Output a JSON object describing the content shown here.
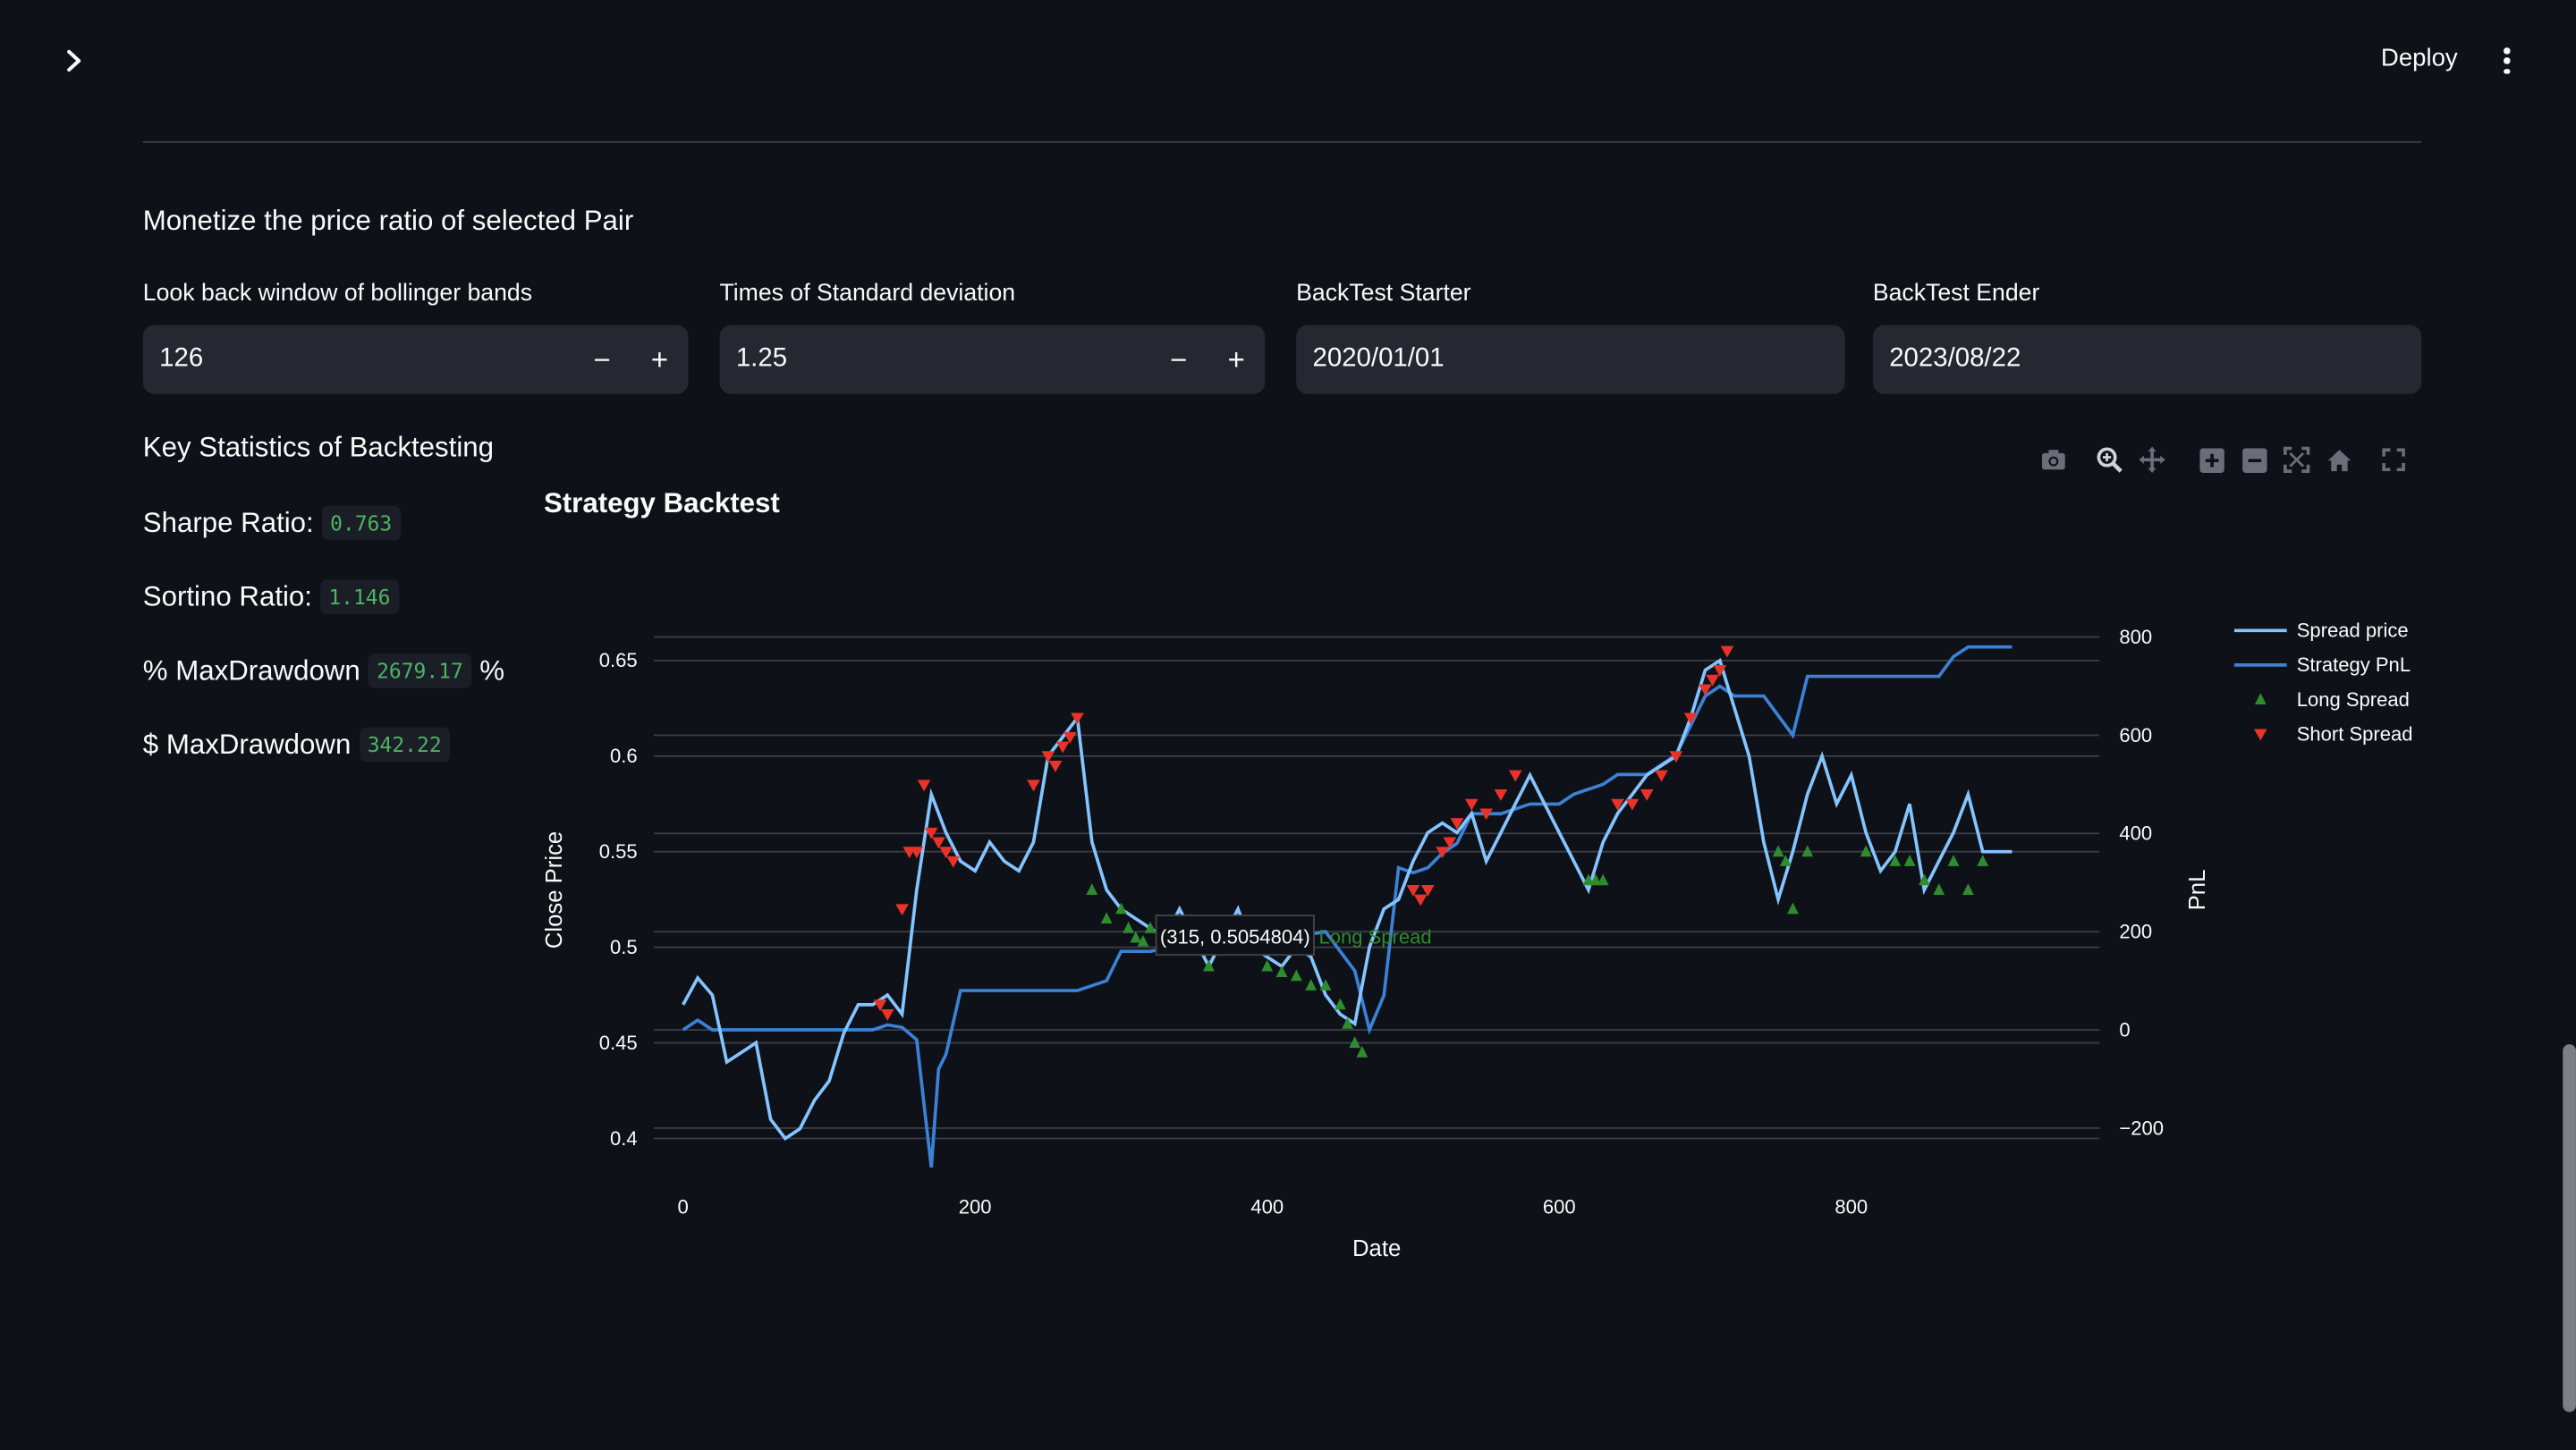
{
  "header": {
    "deploy_label": "Deploy"
  },
  "subtitle": "Monetize the price ratio of selected Pair",
  "inputs": {
    "lookback": {
      "label": "Look back window of bollinger bands",
      "value": "126",
      "minus": "−",
      "plus": "+"
    },
    "std_times": {
      "label": "Times of Standard deviation",
      "value": "1.25",
      "minus": "−",
      "plus": "+"
    },
    "start": {
      "label": "BackTest Starter",
      "value": "2020/01/01"
    },
    "end": {
      "label": "BackTest Ender",
      "value": "2023/08/22"
    }
  },
  "stats": {
    "title": "Key Statistics of Backtesting",
    "sharpe": {
      "label": "Sharpe Ratio:",
      "value": "0.763"
    },
    "sortino": {
      "label": "Sortino Ratio:",
      "value": "1.146"
    },
    "pct_mdd": {
      "label": "% MaxDrawdown",
      "value": "2679.17",
      "suffix": "%"
    },
    "usd_mdd": {
      "label": "$ MaxDrawdown",
      "value": "342.22"
    }
  },
  "modebar_icons": [
    "camera-icon",
    "zoom-icon",
    "pan-icon",
    "zoom-in-icon",
    "zoom-out-icon",
    "autoscale-icon",
    "reset-axes-icon",
    "fullscreen-icon"
  ],
  "chart_data": {
    "type": "line",
    "title": "Strategy Backtest",
    "xlabel": "Date",
    "ylabel": "Close Price",
    "y2label": "PnL",
    "xlim": [
      -20,
      970
    ],
    "ylim": [
      0.39,
      0.67
    ],
    "y2lim": [
      -260,
      830
    ],
    "x_ticks": [
      0,
      200,
      400,
      600,
      800
    ],
    "y_ticks": [
      0.4,
      0.45,
      0.5,
      0.55,
      0.6,
      0.65
    ],
    "y_tick_labels": [
      "0.4",
      "0.45",
      "0.5",
      "0.55",
      "0.6",
      "0.65"
    ],
    "y2_ticks": [
      -200,
      0,
      200,
      400,
      600,
      800
    ],
    "y2_tick_labels": [
      "−200",
      "0",
      "200",
      "400",
      "600",
      "800"
    ],
    "legend_position": "top-right",
    "colors": {
      "spread": "#84c4ff",
      "pnl": "#3b82d6",
      "long": "#2e8b2e",
      "short": "#e8332a",
      "grid": "#3a3d46",
      "text": "#fafafa"
    },
    "series": [
      {
        "name": "Spread price",
        "axis": "y",
        "x": [
          0,
          10,
          20,
          30,
          40,
          50,
          60,
          70,
          80,
          90,
          100,
          110,
          120,
          130,
          140,
          150,
          160,
          170,
          180,
          190,
          200,
          210,
          220,
          230,
          240,
          250,
          260,
          270,
          280,
          290,
          300,
          310,
          320,
          330,
          340,
          350,
          360,
          370,
          380,
          390,
          400,
          410,
          420,
          430,
          440,
          450,
          460,
          470,
          480,
          490,
          500,
          510,
          520,
          530,
          540,
          550,
          560,
          570,
          580,
          590,
          600,
          610,
          620,
          630,
          640,
          650,
          660,
          670,
          680,
          690,
          700,
          710,
          720,
          730,
          740,
          750,
          760,
          770,
          780,
          790,
          800,
          810,
          820,
          830,
          840,
          850,
          860,
          870,
          880,
          890,
          910
        ],
        "values": [
          0.47,
          0.484,
          0.475,
          0.44,
          0.445,
          0.45,
          0.41,
          0.4,
          0.405,
          0.42,
          0.43,
          0.455,
          0.47,
          0.47,
          0.475,
          0.465,
          0.53,
          0.58,
          0.56,
          0.545,
          0.54,
          0.555,
          0.545,
          0.54,
          0.555,
          0.6,
          0.61,
          0.62,
          0.555,
          0.53,
          0.52,
          0.515,
          0.51,
          0.505,
          0.52,
          0.505,
          0.49,
          0.505,
          0.52,
          0.5,
          0.495,
          0.49,
          0.5,
          0.495,
          0.475,
          0.465,
          0.46,
          0.5,
          0.52,
          0.525,
          0.545,
          0.56,
          0.565,
          0.56,
          0.57,
          0.545,
          0.56,
          0.575,
          0.59,
          0.575,
          0.56,
          0.545,
          0.53,
          0.555,
          0.57,
          0.58,
          0.59,
          0.595,
          0.6,
          0.62,
          0.645,
          0.65,
          0.625,
          0.6,
          0.555,
          0.525,
          0.55,
          0.58,
          0.6,
          0.575,
          0.59,
          0.56,
          0.54,
          0.55,
          0.575,
          0.53,
          0.545,
          0.56,
          0.58,
          0.55,
          0.55
        ]
      },
      {
        "name": "Strategy PnL",
        "axis": "y2",
        "x": [
          0,
          10,
          20,
          30,
          40,
          130,
          140,
          150,
          160,
          165,
          170,
          175,
          180,
          190,
          200,
          270,
          280,
          290,
          300,
          320,
          340,
          360,
          380,
          400,
          420,
          440,
          450,
          460,
          470,
          480,
          490,
          500,
          510,
          520,
          530,
          540,
          550,
          560,
          580,
          600,
          610,
          620,
          630,
          640,
          660,
          680,
          700,
          710,
          720,
          740,
          760,
          770,
          780,
          800,
          820,
          840,
          860,
          870,
          880,
          890,
          900,
          910
        ],
        "values": [
          0,
          20,
          0,
          0,
          0,
          0,
          10,
          5,
          -20,
          -150,
          -280,
          -80,
          -50,
          80,
          80,
          80,
          90,
          100,
          160,
          160,
          170,
          175,
          175,
          190,
          190,
          200,
          160,
          120,
          0,
          70,
          330,
          320,
          330,
          360,
          380,
          440,
          440,
          440,
          460,
          460,
          480,
          490,
          500,
          520,
          520,
          560,
          680,
          700,
          680,
          680,
          600,
          720,
          720,
          720,
          720,
          720,
          720,
          760,
          780,
          780,
          780,
          780
        ]
      }
    ],
    "long_spread_x": [
      280,
      290,
      300,
      305,
      310,
      315,
      320,
      330,
      340,
      360,
      380,
      390,
      400,
      410,
      420,
      430,
      440,
      450,
      455,
      460,
      465,
      620,
      625,
      630,
      750,
      755,
      760,
      770,
      810,
      830,
      840,
      850,
      860,
      870,
      880,
      890
    ],
    "long_spread_y": [
      0.53,
      0.515,
      0.52,
      0.51,
      0.505,
      0.503,
      0.51,
      0.5,
      0.505,
      0.49,
      0.505,
      0.5,
      0.49,
      0.487,
      0.485,
      0.48,
      0.48,
      0.47,
      0.46,
      0.45,
      0.445,
      0.535,
      0.535,
      0.535,
      0.55,
      0.545,
      0.52,
      0.55,
      0.55,
      0.545,
      0.545,
      0.535,
      0.53,
      0.545,
      0.53,
      0.545
    ],
    "short_spread_x": [
      135,
      140,
      150,
      155,
      160,
      165,
      170,
      175,
      180,
      185,
      240,
      250,
      255,
      260,
      265,
      270,
      500,
      505,
      510,
      520,
      525,
      530,
      540,
      550,
      560,
      570,
      640,
      650,
      660,
      670,
      680,
      690,
      700,
      705,
      710,
      715
    ],
    "short_spread_y": [
      0.47,
      0.465,
      0.52,
      0.55,
      0.55,
      0.585,
      0.56,
      0.555,
      0.55,
      0.545,
      0.585,
      0.6,
      0.595,
      0.605,
      0.61,
      0.62,
      0.53,
      0.525,
      0.53,
      0.55,
      0.555,
      0.565,
      0.575,
      0.57,
      0.58,
      0.59,
      0.575,
      0.575,
      0.58,
      0.59,
      0.6,
      0.62,
      0.635,
      0.64,
      0.645,
      0.655
    ],
    "hover": {
      "x": 315,
      "y": 0.5054804,
      "text": "(315, 0.5054804)",
      "series": "Long Spread"
    }
  }
}
